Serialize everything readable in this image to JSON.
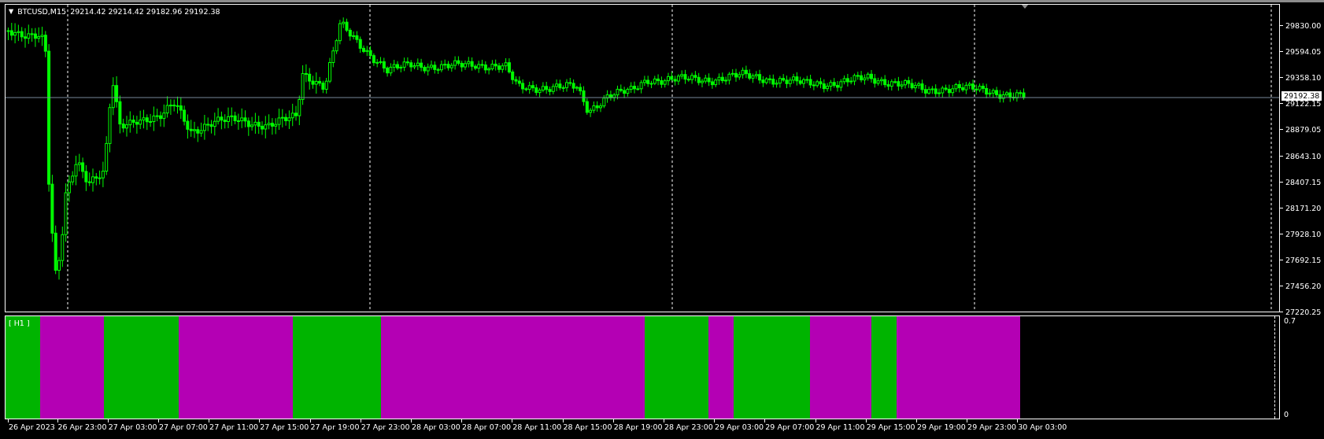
{
  "chart": {
    "menu_icon": "▼",
    "symbol": "BTCUSD,M15",
    "ohlc": "29214.42 29214.42 29182.96 29192.38",
    "current_price": "29192.38",
    "price_axis": [
      "29830.00",
      "29594.05",
      "29358.10",
      "29122.15",
      "28879.05",
      "28643.10",
      "28407.15",
      "28171.20",
      "27928.10",
      "27692.15",
      "27456.20",
      "27220.25"
    ]
  },
  "indicator": {
    "label": "[ H1 ]",
    "axis": [
      "0.7",
      "0"
    ],
    "segments": [
      {
        "color": "#00b400"
      },
      {
        "color": "#b400b4"
      },
      {
        "color": "#00b400"
      },
      {
        "color": "#b400b4"
      },
      {
        "color": "#00b400"
      },
      {
        "color": "#b400b4"
      },
      {
        "color": "#00b400"
      },
      {
        "color": "#b400b4"
      },
      {
        "color": "#00b400"
      },
      {
        "color": "#b400b4"
      },
      {
        "color": "#00b400"
      },
      {
        "color": "#b400b4"
      }
    ]
  },
  "time_axis": [
    "26 Apr 2023",
    "26 Apr 23:00",
    "27 Apr 03:00",
    "27 Apr 07:00",
    "27 Apr 11:00",
    "27 Apr 15:00",
    "27 Apr 19:00",
    "27 Apr 23:00",
    "28 Apr 03:00",
    "28 Apr 07:00",
    "28 Apr 11:00",
    "28 Apr 15:00",
    "28 Apr 19:00",
    "28 Apr 23:00",
    "29 Apr 03:00",
    "29 Apr 07:00",
    "29 Apr 11:00",
    "29 Apr 15:00",
    "29 Apr 19:00",
    "29 Apr 23:00",
    "30 Apr 03:00"
  ]
}
